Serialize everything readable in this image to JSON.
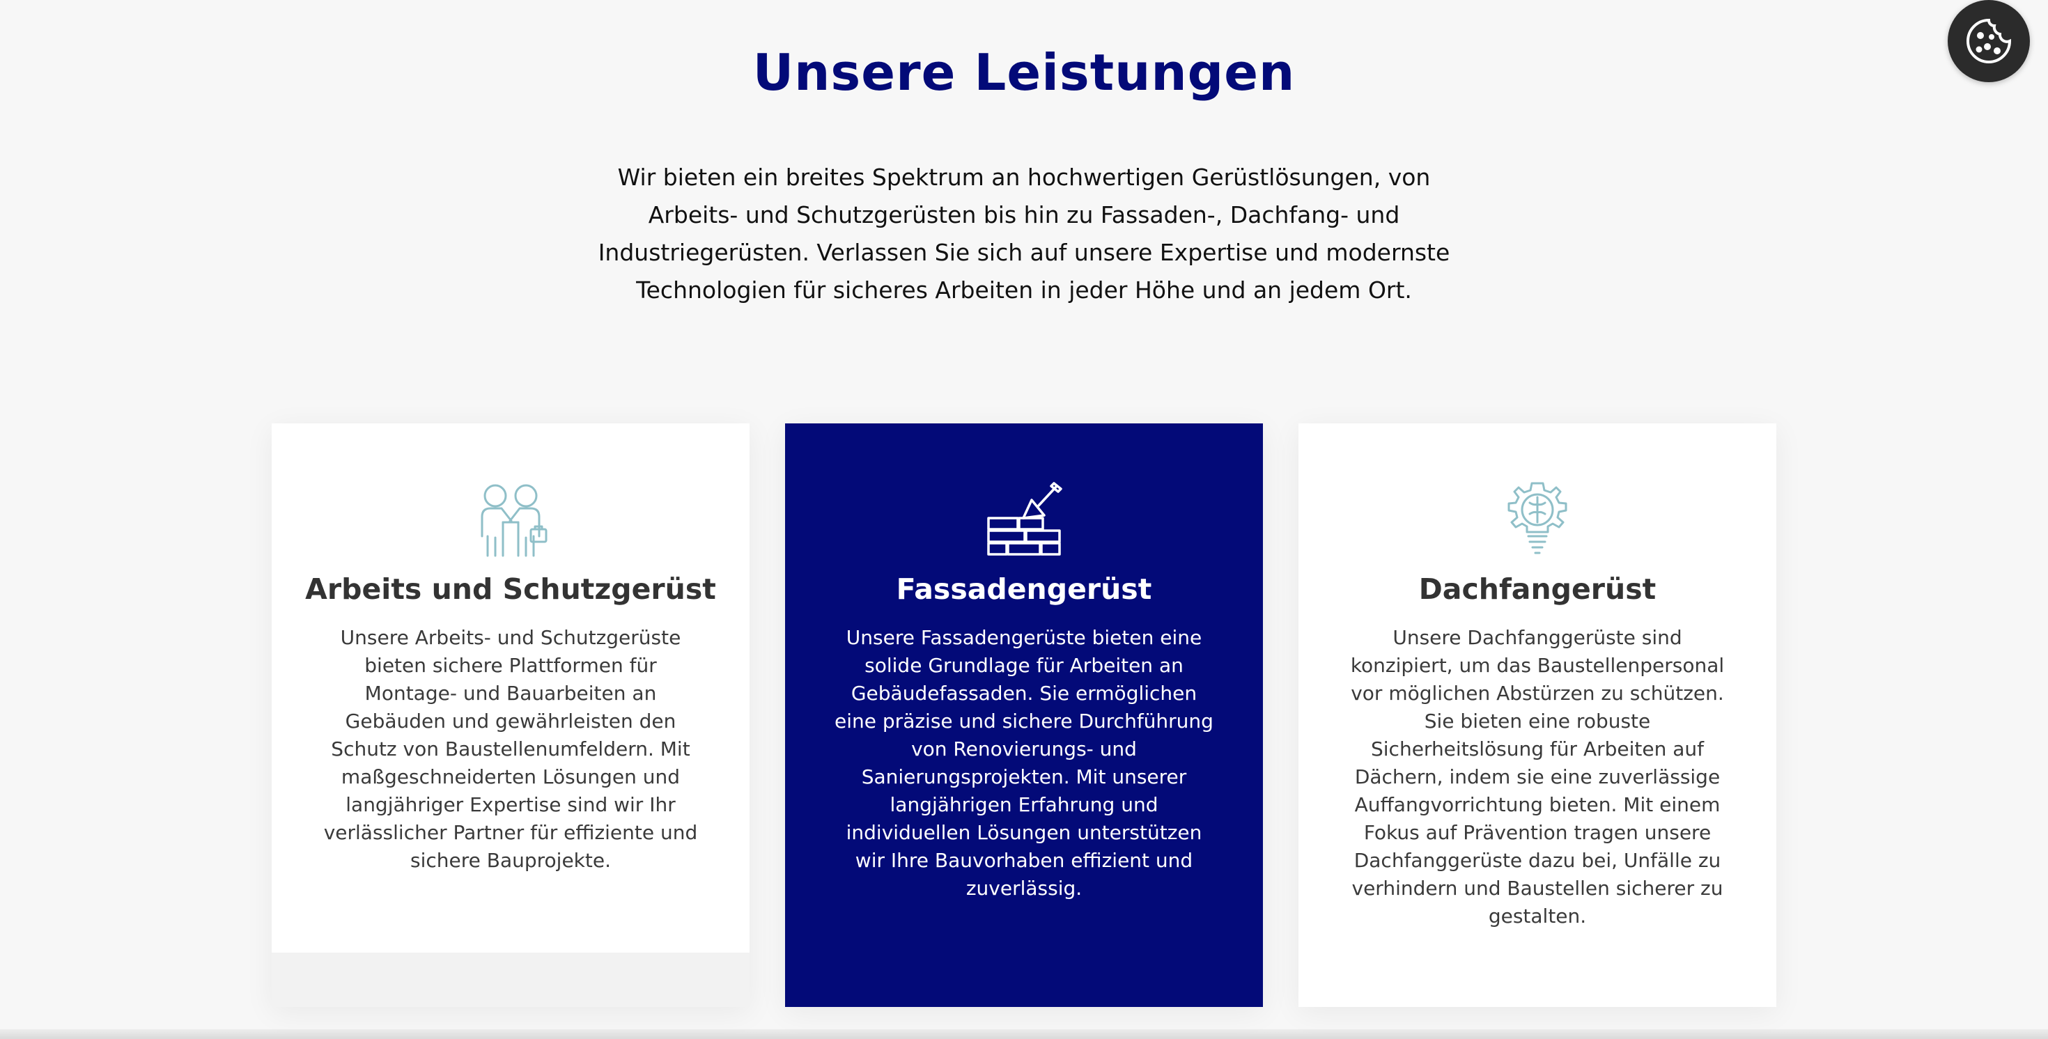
{
  "section": {
    "title": "Unsere Leistungen",
    "intro": "Wir bieten ein breites Spektrum an hochwertigen Gerüstlösungen, von Arbeits- und Schutzgerüsten bis hin zu Fassaden-, Dachfang- und Industriegerüsten. Verlassen Sie sich auf unsere Expertise und modernste Technologien für sicheres Arbeiten in jeder Höhe und an jedem Ort."
  },
  "cards": [
    {
      "title": "Arbeits und Schutzgerüst",
      "text": "Unsere Arbeits- und Schutzgerüste bieten sichere Plattformen für Montage- und Bauarbeiten an Gebäuden und gewährleisten den Schutz von Baustellenumfeldern. Mit maßgeschneiderten Lösungen und langjähriger Expertise sind wir Ihr verlässlicher Partner für effiziente und sichere Bauprojekte.",
      "icon": "handshake-workers-icon"
    },
    {
      "title": "Fassadengerüst",
      "text": "Unsere Fassadengerüste bieten eine solide Grundlage für Arbeiten an Gebäudefassaden. Sie ermöglichen eine präzise und sichere Durchführung von Renovierungs- und Sanierungsprojekten. Mit unserer langjährigen Erfahrung und individuellen Lösungen unterstützen wir Ihre Bauvorhaben effizient und zuverlässig.",
      "icon": "brick-wall-trowel-icon"
    },
    {
      "title": "Dachfangerüst",
      "text": "Unsere Dachfanggerüste sind konzipiert, um das Baustellenpersonal vor möglichen Abstürzen zu schützen. Sie bieten eine robuste Sicherheitslösung für Arbeiten auf Dächern, indem sie eine zuverlässige Auffangvorrichtung bieten. Mit einem Fokus auf Prävention tragen unsere Dachfanggerüste dazu bei, Unfälle zu verhindern und Baustellen sicherer zu gestalten.",
      "icon": "gear-brain-bulb-icon"
    }
  ],
  "cookie": {
    "icon": "cookie-icon"
  },
  "colors": {
    "brand_navy": "#030a78",
    "icon_teal": "#8fbfc8",
    "page_background": "#f7f7f7",
    "card_background": "#ffffff"
  }
}
